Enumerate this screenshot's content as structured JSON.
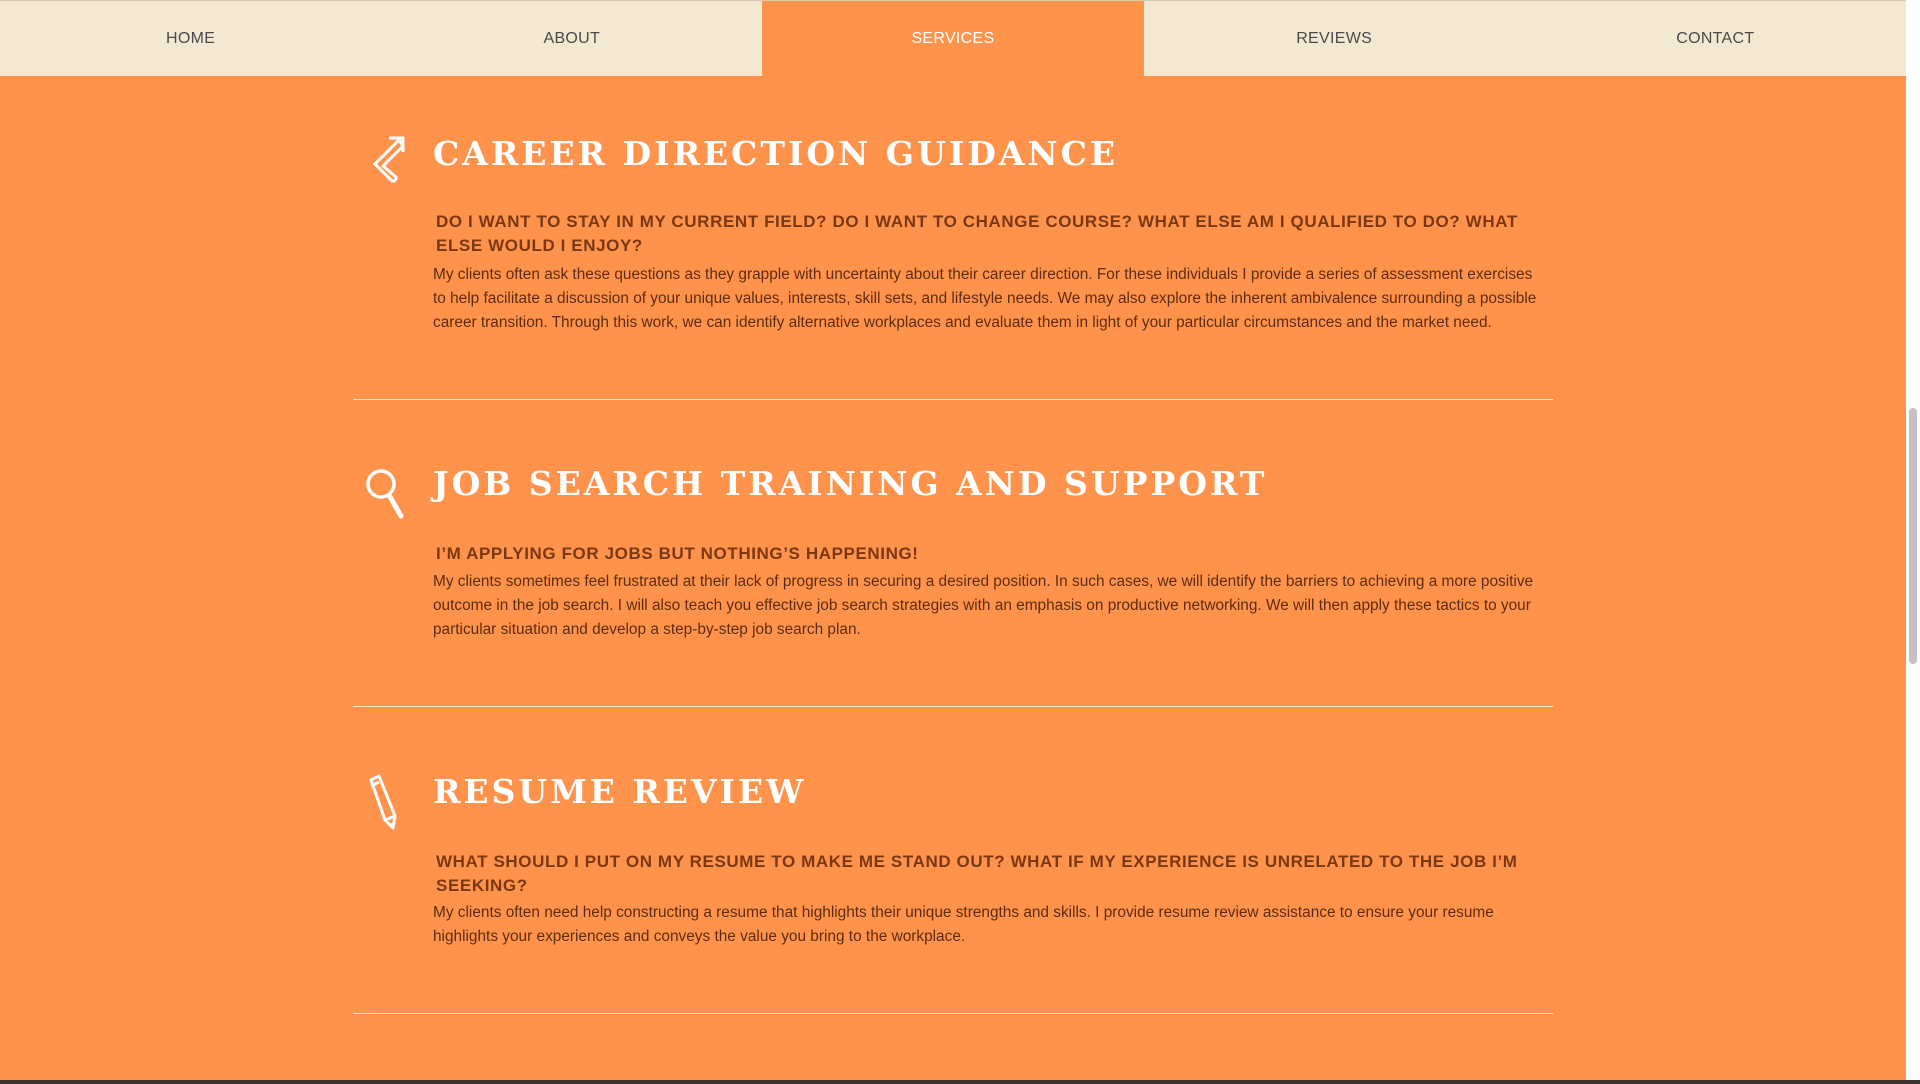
{
  "nav": {
    "items": [
      {
        "label": "HOME"
      },
      {
        "label": "ABOUT"
      },
      {
        "label": "SERVICES"
      },
      {
        "label": "REVIEWS"
      },
      {
        "label": "CONTACT"
      }
    ],
    "active": "SERVICES"
  },
  "sections": [
    {
      "icon": "arrow-icon",
      "title": "CAREER DIRECTION GUIDANCE",
      "question": "DO I WANT TO STAY IN MY CURRENT FIELD? DO I WANT TO CHANGE COURSE? WHAT ELSE AM I QUALIFIED TO DO? WHAT ELSE WOULD I ENJOY?",
      "body": "My clients often ask these questions as they grapple with uncertainty about their career direction. For these individuals I provide a series of assessment exercises to help facilitate a discussion of your unique values, interests, skill sets, and lifestyle needs. We may also explore the inherent ambivalence surrounding a possible career transition. Through this work, we can identify alternative workplaces and evaluate them in light of your particular circumstances and the market need."
    },
    {
      "icon": "magnifier-icon",
      "title": "JOB SEARCH TRAINING AND SUPPORT",
      "question": "I’M APPLYING FOR JOBS BUT NOTHING’S HAPPENING!",
      "body": "My clients sometimes feel frustrated at their lack of progress in securing a desired position. In such cases, we will identify the barriers to achieving a more positive outcome in the job search. I will also teach you effective job search strategies with an emphasis on productive networking. We will then apply these tactics to your particular situation and develop a step-by-step job search plan."
    },
    {
      "icon": "pencil-icon",
      "title": "RESUME REVIEW",
      "question": "WHAT SHOULD I PUT ON MY RESUME TO MAKE ME STAND OUT? WHAT IF MY EXPERIENCE IS UNRELATED TO THE JOB I’M SEEKING?",
      "body": "My clients often need help constructing a resume that highlights their unique strengths and skills. I provide resume review assistance to ensure your resume highlights your experiences and conveys the value you bring to the workplace."
    }
  ],
  "colors": {
    "background": "#ff934b",
    "nav_background": "#f3e8d2",
    "question_text": "#7a3812",
    "body_text": "#5c2c10"
  }
}
